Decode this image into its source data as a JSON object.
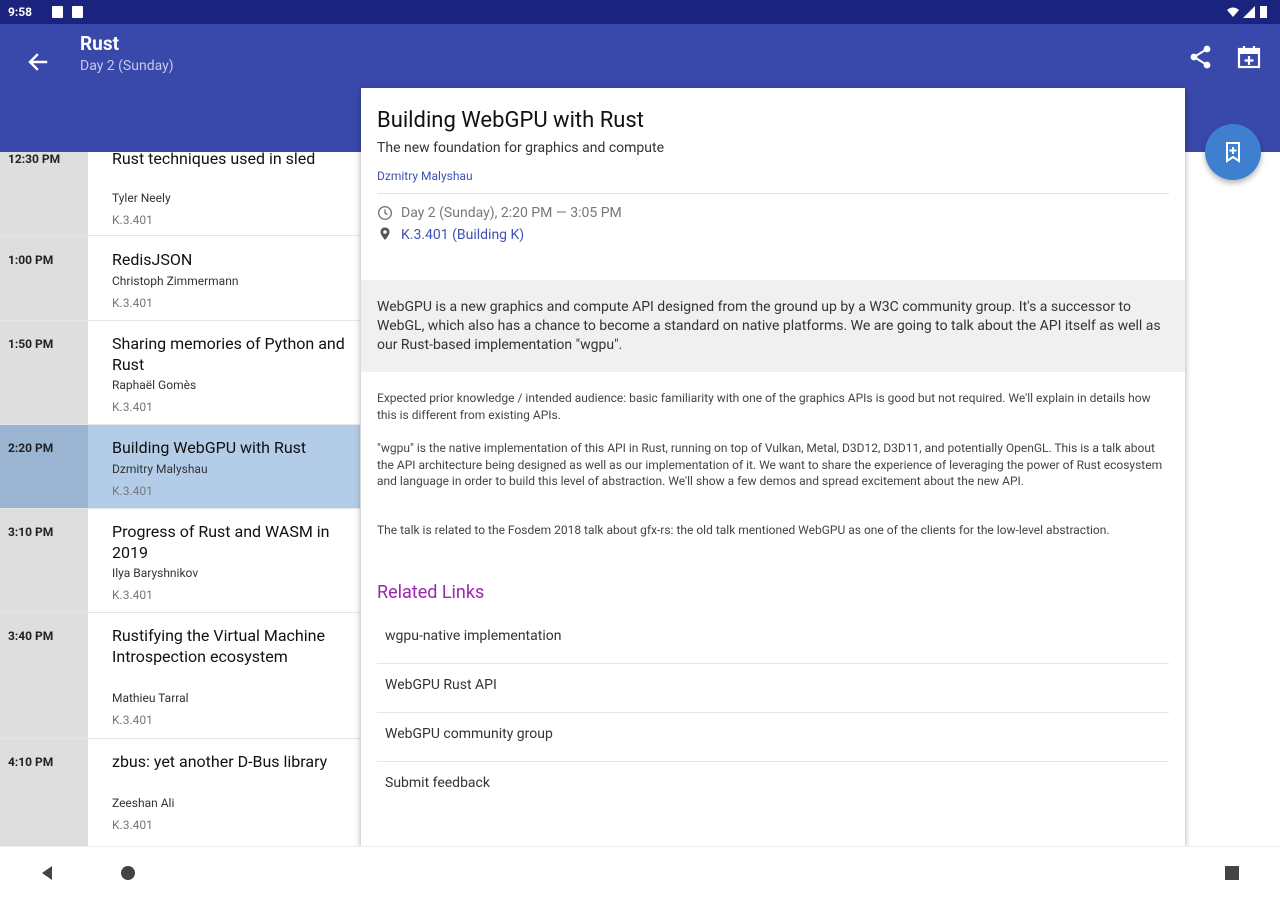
{
  "statusbar": {
    "time": "9:58"
  },
  "appbar": {
    "title": "Rust",
    "subtitle": "Day 2 (Sunday)"
  },
  "schedule": [
    {
      "time": "12:30 PM",
      "title": "Rust techniques used in sled",
      "speaker": "Tyler Neely",
      "room": "K.3.401"
    },
    {
      "time": "1:00 PM",
      "title": "RedisJSON",
      "speaker": "Christoph Zimmermann",
      "room": "K.3.401"
    },
    {
      "time": "1:50 PM",
      "title": "Sharing memories of Python and Rust",
      "speaker": "Raphaël Gomès",
      "room": "K.3.401"
    },
    {
      "time": "2:20 PM",
      "title": "Building WebGPU with Rust",
      "speaker": "Dzmitry Malyshau",
      "room": "K.3.401"
    },
    {
      "time": "3:10 PM",
      "title": "Progress of Rust and WASM in 2019",
      "speaker": "Ilya Baryshnikov",
      "room": "K.3.401"
    },
    {
      "time": "3:40 PM",
      "title": "Rustifying the Virtual Machine Introspection ecosystem",
      "speaker": "Mathieu Tarral",
      "room": "K.3.401"
    },
    {
      "time": "4:10 PM",
      "title": "zbus: yet another D-Bus library",
      "speaker": "Zeeshan Ali",
      "room": "K.3.401"
    }
  ],
  "detail": {
    "title": "Building WebGPU with Rust",
    "subtitle": "The new foundation for graphics and compute",
    "speaker": "Dzmitry Malyshau",
    "datetime": "Day 2 (Sunday), 2:20 PM — 3:05 PM",
    "room": "K.3.401 (Building K)",
    "abstract": "WebGPU is a new graphics and compute API designed from the ground up by a W3C community group. It's a successor to WebGL, which also has a chance to become a standard on native platforms. We are going to talk about the API itself as well as our Rust-based implementation \"wgpu\".",
    "desc1": "Expected prior knowledge / intended audience: basic familiarity with one of the graphics APIs is good but not required. We'll explain in details how this is different from existing APIs.",
    "desc2": "\"wgpu\" is the native implementation of this API in Rust, running on top of Vulkan, Metal, D3D12, D3D11, and potentially OpenGL. This is a talk about the API architecture being designed as well as our implementation of it. We want to share the experience of leveraging the power of Rust ecosystem and language in order to build this level of abstraction. We'll show a few demos and spread excitement about the new API.",
    "desc3": "The talk is related to the Fosdem 2018 talk about gfx-rs: the old talk mentioned WebGPU as one of the clients for the low-level abstraction.",
    "related_heading": "Related Links",
    "links": [
      "wgpu-native implementation",
      "WebGPU Rust API",
      "WebGPU community group",
      "Submit feedback"
    ]
  },
  "colors": {
    "appbar": "#3949ab",
    "statusbar": "#1a237e",
    "selected": "#b3cde8",
    "accent": "#9c27b0",
    "link": "#3f51b5"
  }
}
